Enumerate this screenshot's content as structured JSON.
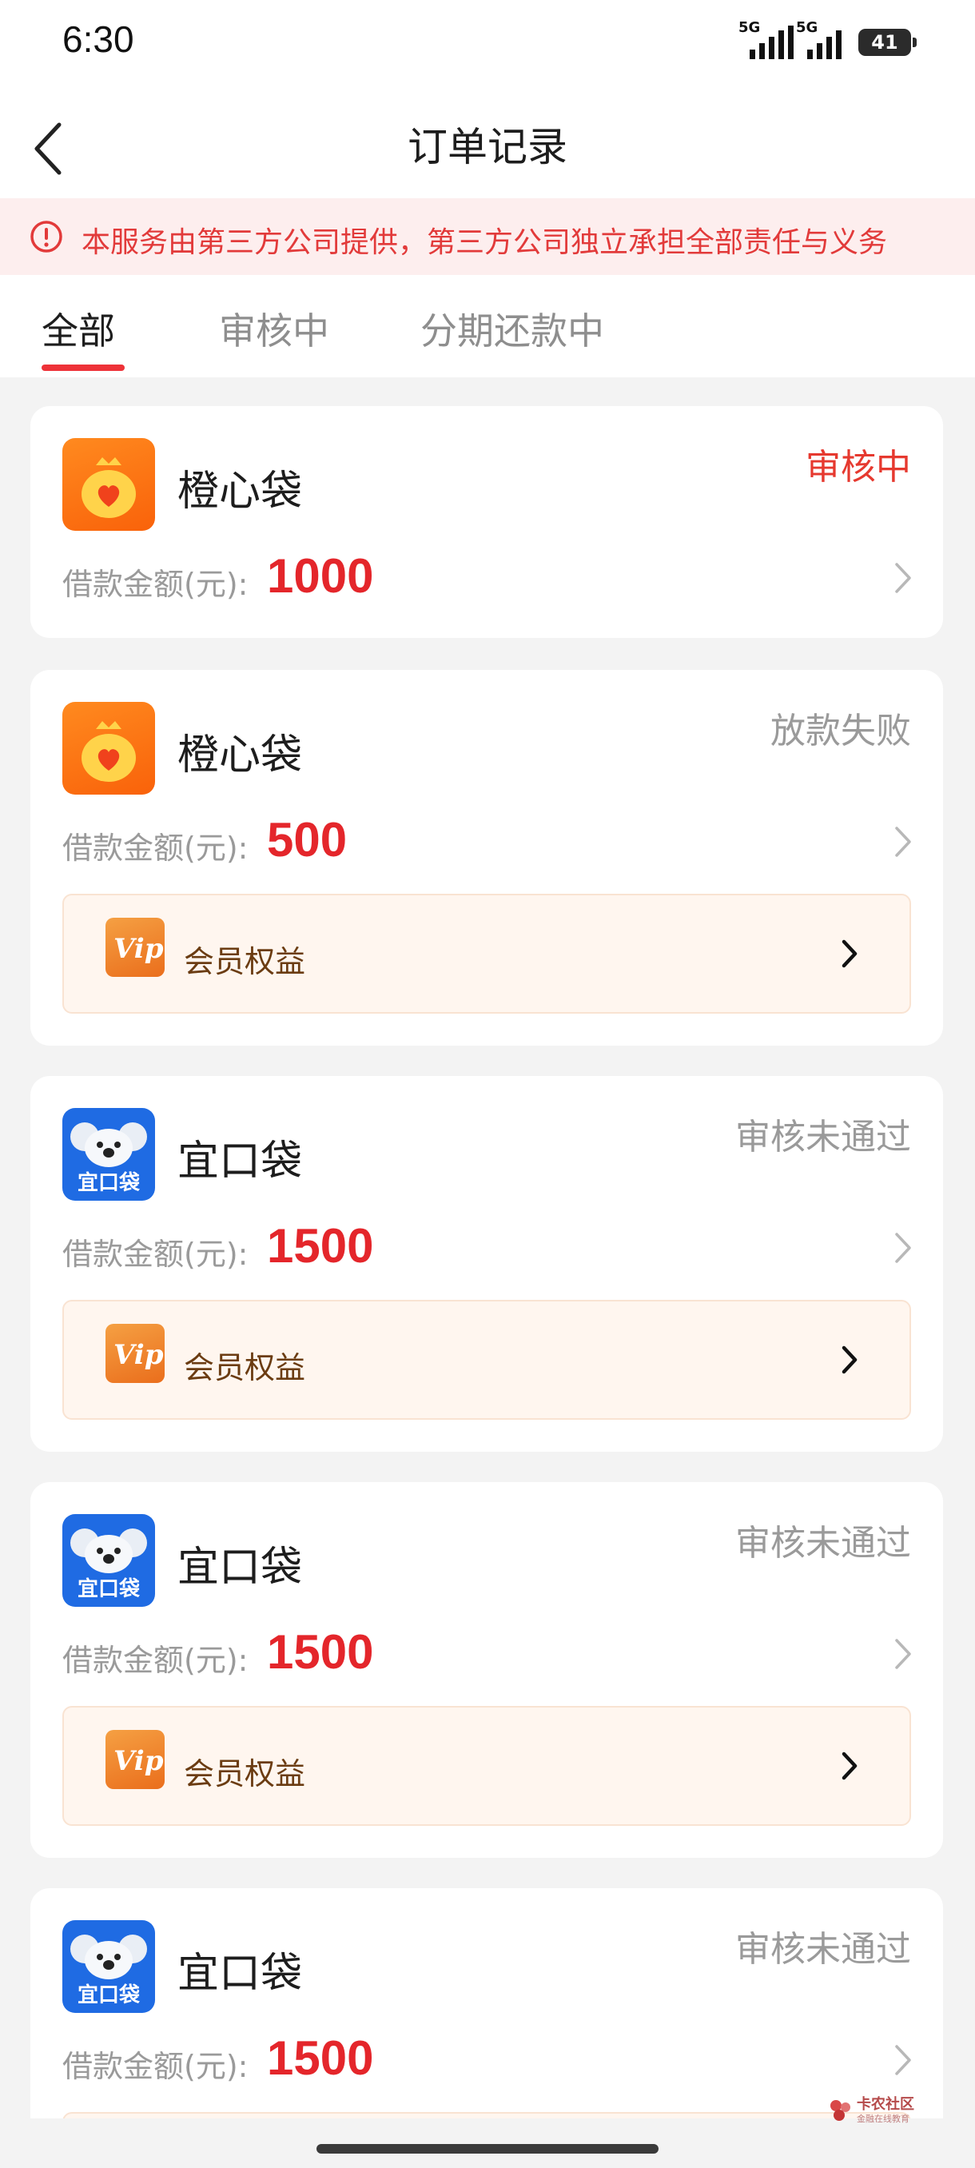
{
  "status_bar": {
    "time": "6:30",
    "network_1": "5G",
    "network_2": "5G",
    "battery": "41"
  },
  "header": {
    "title": "订单记录"
  },
  "notice": {
    "text": "本服务由第三方公司提供，第三方公司独立承担全部责任与义务"
  },
  "tabs": [
    {
      "label": "全部",
      "active": true
    },
    {
      "label": "审核中",
      "active": false
    },
    {
      "label": "分期还款中",
      "active": false
    }
  ],
  "orders": [
    {
      "app_name": "橙心袋",
      "icon": "money-bag-heart-icon",
      "status": "审核中",
      "status_color": "#e6392f",
      "amount_label": "借款金额(元):",
      "amount": "1000"
    },
    {
      "app_name": "橙心袋",
      "icon": "money-bag-heart-icon",
      "status": "放款失败",
      "status_color": "#9a9a9a",
      "amount_label": "借款金额(元):",
      "amount": "500",
      "vip_label": "会员权益"
    },
    {
      "app_name": "宜口袋",
      "icon": "koala-icon",
      "icon_text": "宜口袋",
      "status": "审核未通过",
      "status_color": "#9a9a9a",
      "amount_label": "借款金额(元):",
      "amount": "1500",
      "vip_label": "会员权益"
    },
    {
      "app_name": "宜口袋",
      "icon": "koala-icon",
      "icon_text": "宜口袋",
      "status": "审核未通过",
      "status_color": "#9a9a9a",
      "amount_label": "借款金额(元):",
      "amount": "1500",
      "vip_label": "会员权益"
    },
    {
      "app_name": "宜口袋",
      "icon": "koala-icon",
      "icon_text": "宜口袋",
      "status": "审核未通过",
      "status_color": "#9a9a9a",
      "amount_label": "借款金额(元):",
      "amount": "1500"
    }
  ],
  "vip_badge_text": "Vip",
  "watermark": {
    "title": "卡农社区",
    "subtitle": "金融在线教育"
  },
  "colors": {
    "accent_red": "#ee3238",
    "amount_red": "#e4262b",
    "notice_bg": "#fdeeee",
    "vip_bg": "#fff6ef"
  }
}
